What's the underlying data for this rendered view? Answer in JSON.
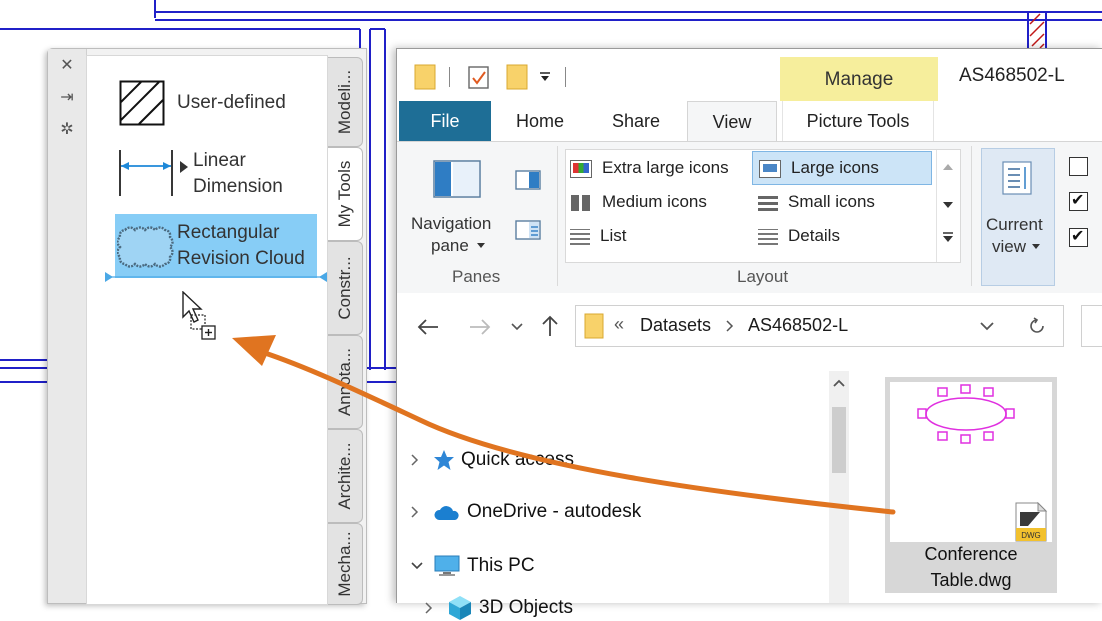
{
  "colors": {
    "accent": "#1e6e96",
    "manage_tab": "#f6ee9c",
    "selection": "#87cdf6",
    "cad_line": "#2020c8",
    "drag_arrow": "#e07420",
    "hatch_red": "#c01818"
  },
  "palette": {
    "strip_icons": [
      "close-icon",
      "pin-icon",
      "gear-icon"
    ],
    "tools": [
      {
        "label": "User-defined",
        "icon": "hatch-icon"
      },
      {
        "label_line1": "Linear",
        "label_line2": "Dimension",
        "icon": "linear-dimension-icon"
      },
      {
        "label_line1": "Rectangular",
        "label_line2": "Revision Cloud",
        "icon": "revision-cloud-icon",
        "selected": true
      }
    ],
    "tabs": [
      "Modeli...",
      "My Tools",
      "Constr...",
      "Annota...",
      "Archite...",
      "Mecha..."
    ],
    "active_tab": "My Tools"
  },
  "explorer": {
    "title": "AS468502-L",
    "contextual_tab": "Manage",
    "ribbon_tabs": [
      "File",
      "Home",
      "Share",
      "View",
      "Picture Tools"
    ],
    "active_tab": "View",
    "panes": {
      "nav_label_line1": "Navigation",
      "nav_label_line2": "pane",
      "caption": "Panes"
    },
    "layout": {
      "items": [
        "Extra large icons",
        "Large icons",
        "Medium icons",
        "Small icons",
        "List",
        "Details"
      ],
      "selected": "Large icons",
      "caption": "Layout"
    },
    "current_view": {
      "line1": "Current",
      "line2": "view"
    },
    "checkboxes": [
      false,
      true,
      true
    ],
    "address": {
      "crumbs": [
        "Datasets",
        "AS468502-L"
      ],
      "prefix": "«"
    },
    "nav_items": [
      {
        "label": "Quick access",
        "icon": "star-icon"
      },
      {
        "label": "OneDrive - autodesk",
        "icon": "cloud-icon"
      },
      {
        "label": "This PC",
        "icon": "pc-icon",
        "expanded": true
      },
      {
        "label": "3D Objects",
        "icon": "cube-icon"
      }
    ],
    "file": {
      "name_line1": "Conference",
      "name_line2": "Table.dwg",
      "badge": "DWG"
    }
  }
}
